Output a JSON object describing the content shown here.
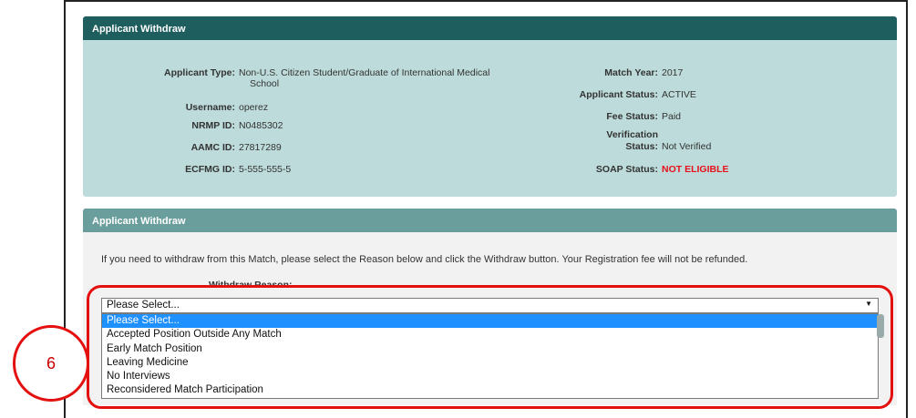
{
  "panel1": {
    "title": "Applicant Withdraw"
  },
  "applicant": {
    "type_label": "Applicant Type:",
    "type_value_line1": "Non-U.S. Citizen Student/Graduate of International Medical",
    "type_value_line2": "School",
    "username_label": "Username:",
    "username_value": "operez",
    "nrmp_label": "NRMP ID:",
    "nrmp_value": "N0485302",
    "aamc_label": "AAMC ID:",
    "aamc_value": "27817289",
    "ecfmg_label": "ECFMG ID:",
    "ecfmg_value": "5-555-555-5",
    "match_year_label": "Match Year:",
    "match_year_value": "2017",
    "status_label": "Applicant Status:",
    "status_value": "ACTIVE",
    "fee_label": "Fee Status:",
    "fee_value": "Paid",
    "verification_label_line1": "Verification",
    "verification_label_line2": "Status:",
    "verification_value": "Not Verified",
    "soap_label": "SOAP Status:",
    "soap_value": "NOT ELIGIBLE",
    "soap_color": "#e8111b"
  },
  "panel2": {
    "title": "Applicant Withdraw",
    "instructions": "If you need to withdraw from this Match, please select the Reason below and click the Withdraw button. Your Registration fee will not be refunded.",
    "reason_label": "Withdraw Reason:"
  },
  "select": {
    "value": "Please Select...",
    "options": [
      "Please Select...",
      "Accepted Position Outside Any Match",
      "Early Match Position",
      "Leaving Medicine",
      "No Interviews",
      "Reconsidered Match Participation"
    ],
    "highlight_color": "#1e90ff"
  },
  "annotation": {
    "step_number": "6",
    "color": "#e41010"
  }
}
